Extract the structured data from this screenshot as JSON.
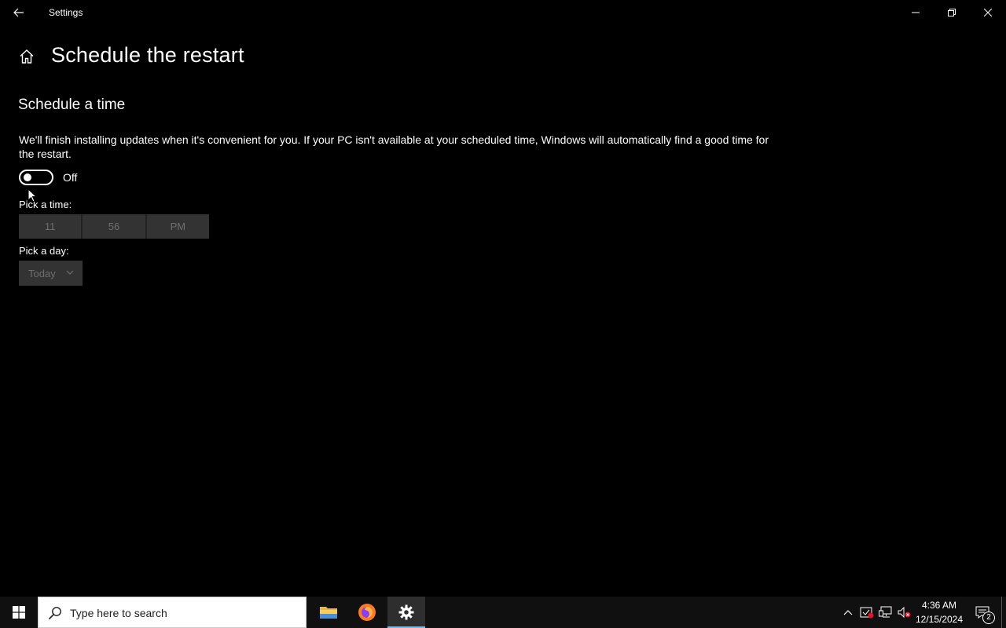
{
  "window": {
    "title": "Settings"
  },
  "page": {
    "title": "Schedule the restart",
    "section_title": "Schedule a time",
    "description": "We'll finish installing updates when it's convenient for you. If your PC isn't available at your scheduled time, Windows will automatically find a good time for the restart.",
    "toggle": {
      "state_label": "Off",
      "on": false
    },
    "pick_time_label": "Pick a time:",
    "time": {
      "hour": "11",
      "minute": "56",
      "period": "PM"
    },
    "pick_day_label": "Pick a day:",
    "day": {
      "selected": "Today"
    }
  },
  "taskbar": {
    "search_placeholder": "Type here to search",
    "apps": [
      {
        "name": "File Explorer",
        "icon": "folder-icon"
      },
      {
        "name": "Firefox",
        "icon": "firefox-icon"
      },
      {
        "name": "Settings",
        "icon": "gear-icon",
        "active": true
      }
    ],
    "clock": {
      "time": "4:36 AM",
      "date": "12/15/2024"
    },
    "notification_count": "2"
  },
  "colors": {
    "background": "#000000",
    "taskbar": "#101010",
    "picker_bg": "#333333",
    "picker_text_disabled": "#6e6e6e",
    "active_indicator": "#76b9ed"
  }
}
